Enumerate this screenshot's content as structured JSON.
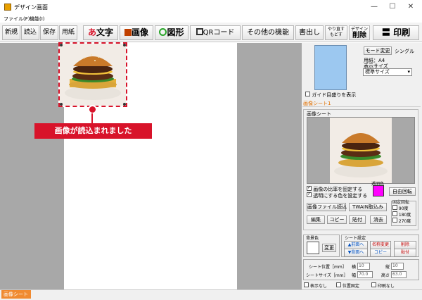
{
  "window": {
    "title": "デザイン画面",
    "minimize": "—",
    "maximize": "☐",
    "close": "✕"
  },
  "menu": [
    "ファイル(F)",
    "機能(I)"
  ],
  "toolbar": {
    "new": "新規",
    "load": "読込",
    "save": "保存",
    "paper": "用紙",
    "text": "文字",
    "text_prefix": "あ",
    "image": "画像",
    "shape": "図形",
    "qr": "QRコード",
    "other": "その他の機能",
    "export": "書出し",
    "undo_top": "やり直す",
    "undo_bottom": "もどす",
    "delete_top": "デザイン",
    "delete_bottom": "削除",
    "print": "印刷"
  },
  "callout": {
    "text": "画像が読込まれました"
  },
  "right_panel": {
    "mode_button": "モード変更",
    "mode_value": "シングル",
    "paper_label": "用紙：A4",
    "display_size_label": "表示サイズ",
    "display_size_value": "標準サイズ",
    "guide_label": "ガイド目盛りを表示",
    "sheet_tab": "画像シート1",
    "image_sheet_title": "画像シート",
    "keep_ratio": "画像の比率を固定する",
    "transparent_set": "透明にする色を設定する",
    "transparent_label": "透明色",
    "free_rotate": "自由回転",
    "load_image": "画像ファイル読込",
    "twain": "TWAIN取込み",
    "fixed_rotate": "固定回転",
    "rot_90": "90度",
    "rot_180": "180度",
    "rot_270": "270度",
    "edit": "編集",
    "copy": "コピー",
    "paste": "貼付",
    "erase": "消去",
    "bg_color": "背景色",
    "change": "変更",
    "sheet_settings": "シート設定",
    "to_front": "▲前面へ",
    "to_back": "▼背面へ",
    "rename": "名称変更",
    "sheet_copy": "コピー",
    "sheet_delete": "削除",
    "sheet_paste": "貼付",
    "pos_label": "シート位置［mm］",
    "size_label": "シートサイズ［mm］",
    "x_label": "横",
    "x_value": "10",
    "y_label": "縦",
    "y_value": "10",
    "w_label": "幅",
    "w_value": "70.0",
    "h_label": "高さ",
    "h_value": "63.0",
    "hide": "表示なし",
    "lock_pos": "位置固定",
    "no_print": "印刷なし"
  },
  "status": {
    "tab": "画像シート1"
  },
  "colors": {
    "accent": "#d8132a",
    "transparent_color": "#ff00ff",
    "preview_paper": "#9cc8f0"
  }
}
